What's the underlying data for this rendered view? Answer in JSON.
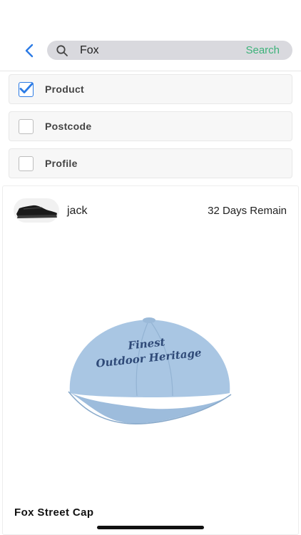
{
  "header": {
    "search": {
      "query": "Fox",
      "action_label": "Search"
    }
  },
  "filters": [
    {
      "label": "Product",
      "checked": true
    },
    {
      "label": "Postcode",
      "checked": false
    },
    {
      "label": "Profile",
      "checked": false
    }
  ],
  "listing": {
    "username": "jack",
    "time_remaining": "32 Days Remain",
    "product_title": "Fox Street Cap",
    "cap_embroidery_line1": "Finest",
    "cap_embroidery_line2": "Outdoor Heritage"
  },
  "colors": {
    "accent_blue": "#2c7be5",
    "search_green": "#3db27a",
    "search_bg": "#d9d9de",
    "cap_blue": "#a9c6e3",
    "embroidery": "#2f4a78"
  }
}
